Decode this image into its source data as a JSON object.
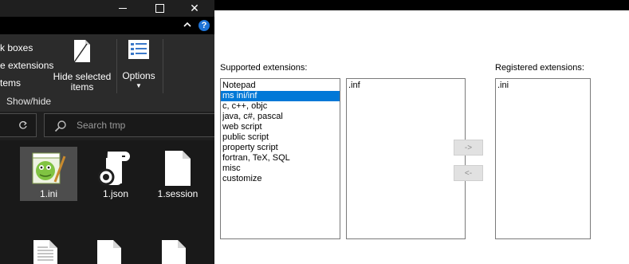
{
  "explorer": {
    "ribbon": {
      "options_list": [
        "k boxes",
        "e extensions",
        "tems"
      ],
      "group_label": "Show/hide",
      "hide_selected_label": "Hide selected items",
      "options_label": "Options"
    },
    "search": {
      "placeholder": "Search tmp"
    },
    "files": [
      {
        "name": "1.ini",
        "icon": "notepad-plus-icon"
      },
      {
        "name": "1.json",
        "icon": "json-icon"
      },
      {
        "name": "1.session",
        "icon": "blank-file-icon"
      }
    ]
  },
  "dialog": {
    "supported_label": "Supported extensions:",
    "registered_label": "Registered extensions:",
    "supported_items": [
      "Notepad",
      "ms ini/inf",
      "c, c++, objc",
      "java, c#, pascal",
      "web script",
      "public script",
      "property script",
      "fortran, TeX, SQL",
      "misc",
      "customize"
    ],
    "selected_supported": "ms ini/inf",
    "middle_items": [
      ".inf"
    ],
    "registered_items": [
      ".ini"
    ],
    "add_button": "->",
    "remove_button": "<-"
  },
  "colors": {
    "selection": "#0078d7",
    "explorer_bg": "#1f1f1f",
    "help_icon": "#1e73d6"
  }
}
